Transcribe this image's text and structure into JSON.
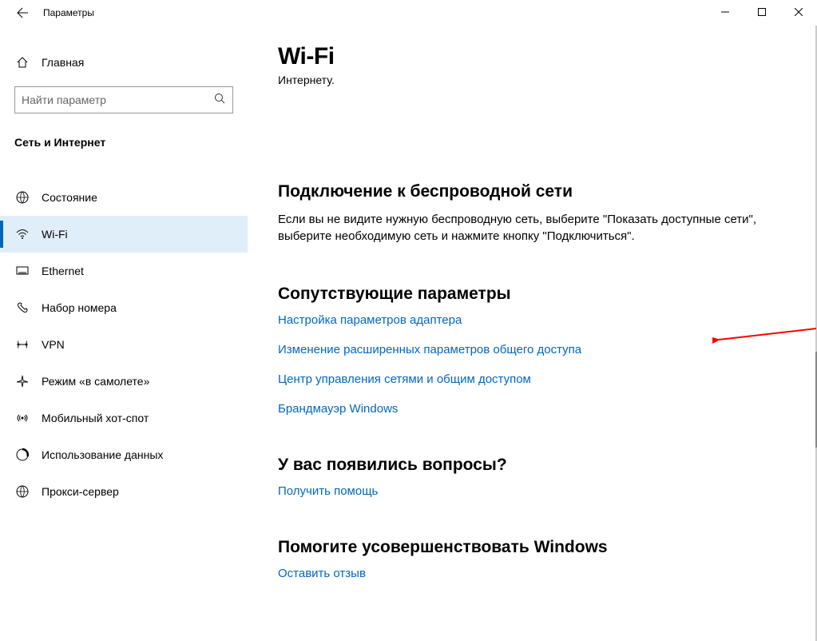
{
  "window": {
    "title": "Параметры"
  },
  "sidebar": {
    "home_label": "Главная",
    "search_placeholder": "Найти параметр",
    "category_title": "Сеть и Интернет",
    "items": [
      {
        "label": "Состояние"
      },
      {
        "label": "Wi-Fi",
        "selected": true
      },
      {
        "label": "Ethernet"
      },
      {
        "label": "Набор номера"
      },
      {
        "label": "VPN"
      },
      {
        "label": "Режим «в самолете»"
      },
      {
        "label": "Мобильный хот-спот"
      },
      {
        "label": "Использование данных"
      },
      {
        "label": "Прокси-сервер"
      }
    ]
  },
  "main": {
    "title": "Wi-Fi",
    "subtext": "Интернету.",
    "sections": {
      "connect": {
        "title": "Подключение к беспроводной сети",
        "body": "Если вы не видите нужную беспроводную сеть, выберите \"Показать доступные сети\", выберите необходимую сеть и нажмите кнопку \"Подключиться\"."
      },
      "related": {
        "title": "Сопутствующие параметры",
        "links": [
          "Настройка параметров адаптера",
          "Изменение расширенных параметров общего доступа",
          "Центр управления сетями и общим доступом",
          "Брандмауэр Windows"
        ]
      },
      "questions": {
        "title": "У вас появились вопросы?",
        "link": "Получить помощь"
      },
      "improve": {
        "title": "Помогите усовершенствовать Windows",
        "link": "Оставить отзыв"
      }
    }
  }
}
